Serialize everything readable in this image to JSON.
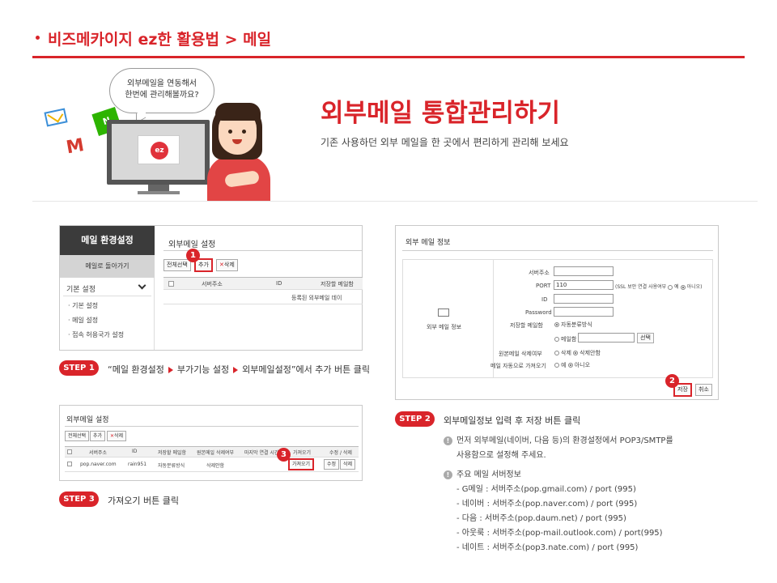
{
  "header": {
    "title": "비즈메카이지 ez한 활용법 > 메일"
  },
  "hero": {
    "bubble_line1": "외부메일을 연동해서",
    "bubble_line2": "한번에 관리해볼까요?",
    "title": "외부메일 통합관리하기",
    "subtitle": "기존 사용하던 외부 메일을  한 곳에서 편리하게 관리해 보세요",
    "badge": "ez",
    "gmail_glyph": "M",
    "naver_glyph": "N"
  },
  "shot1": {
    "sidebar_title": "메일 환경설정",
    "back_button": "메일로 돌아가기",
    "section": "기본 설정",
    "items": [
      "· 기본 설정",
      "· 메일 설정",
      "· 접속 허용국가 설정"
    ],
    "panel_title": "외부메일 설정",
    "btn_select_all": "전체선택",
    "btn_add": "추가",
    "btn_delete": "삭제",
    "col_server": "서버주소",
    "col_id": "ID",
    "col_save_mailbox": "저장할 메일함",
    "empty_row": "등록된 외부메일 데이",
    "marker": "1"
  },
  "step1": {
    "label": "STEP 1",
    "part1": "“메일 환경설정",
    "part2": "부가기능 설정",
    "part3": "외부메일설정”에서 추가 버튼 클릭"
  },
  "shot2": {
    "title": "외부 메일 정보",
    "left_label": "외부 메일 정보",
    "lbl_server": "서버주소",
    "lbl_port": "PORT",
    "port_value": "110",
    "ssl_text": "(SSL 보안 연결 사용여부",
    "ssl_yes": "예",
    "ssl_no": "아니오)",
    "lbl_id": "ID",
    "lbl_password": "Password",
    "lbl_save_mailbox": "저장할 메일함",
    "opt_auto": "자동분류방식",
    "opt_mailbox": "메일함",
    "btn_choose": "선택",
    "lbl_delete_orig": "원본메일 삭제여부",
    "opt_delete": "삭제",
    "opt_nodelete": "삭제안함",
    "lbl_auto_fetch": "메일 자동으로 가져오기",
    "opt_yes": "예",
    "opt_no": "아니오",
    "btn_save": "저장",
    "btn_cancel": "취소",
    "marker": "2"
  },
  "step2": {
    "label": "STEP 2",
    "text": "외부메일정보 입력 후 저장 버튼 클릭",
    "note1_line1": "먼저 외부메일(네이버, 다음 등)의 환경설정에서 POP3/SMTP를",
    "note1_line2": "사용함으로 설정해 주세요.",
    "note2_title": "주요 메일 서버정보",
    "servers": [
      "- G메일 : 서버주소(pop.gmail.com) / port (995)",
      "- 네이버 : 서버주소(pop.naver.com) / port (995)",
      "- 다음 : 서버주소(pop.daum.net) / port (995)",
      "- 아웃룩 : 서버주소(pop-mail.outlook.com) / port(995)",
      "- 네이트 : 서버주소(pop3.nate.com) / port (995)"
    ]
  },
  "shot3": {
    "title": "외부메일 설정",
    "btn_select_all": "전체선택",
    "btn_add": "추가",
    "btn_delete": "삭제",
    "cols": [
      "서버주소",
      "ID",
      "저장할 메일함",
      "원본메일 삭제여부",
      "마지막 연결 시간",
      "가져오기",
      "수정 / 삭제"
    ],
    "row": [
      "pop.naver.com",
      "rain951",
      "자동분류방식",
      "삭제안함",
      "",
      "가져오기",
      "수정",
      "삭제"
    ],
    "marker": "3"
  },
  "step3": {
    "label": "STEP 3",
    "text": "가져오기 버튼 클릭"
  },
  "colors": {
    "accent": "#d9242a"
  }
}
